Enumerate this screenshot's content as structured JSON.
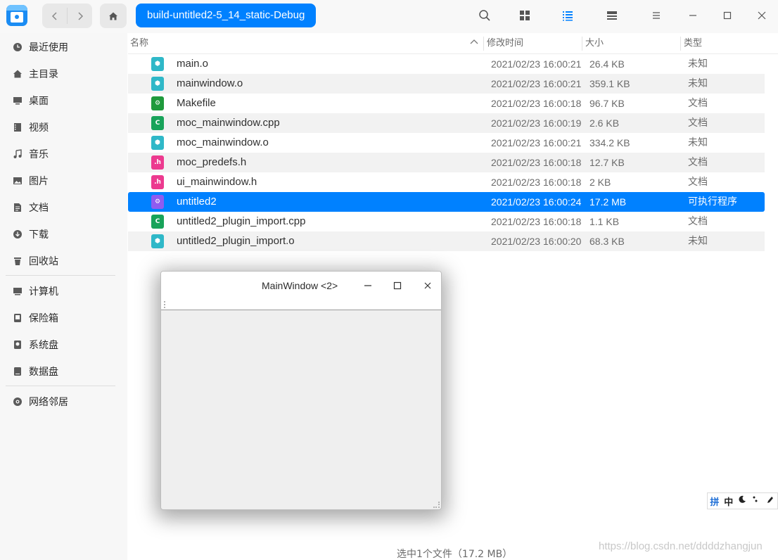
{
  "toolbar": {
    "back_icon": "chevron-left-icon",
    "forward_icon": "chevron-right-icon",
    "home_icon": "home-icon",
    "breadcrumb": "build-untitled2-5_14_static-Debug",
    "icons": [
      "search-icon",
      "icon-view-icon",
      "list-view-icon",
      "detail-view-icon",
      "menu-icon",
      "minimize-icon",
      "maximize-icon",
      "close-icon"
    ]
  },
  "sidebar": {
    "items": [
      {
        "label": "最近使用",
        "icon": "clock-icon"
      },
      {
        "label": "主目录",
        "icon": "home-icon"
      },
      {
        "label": "桌面",
        "icon": "desktop-icon"
      },
      {
        "label": "视频",
        "icon": "video-icon"
      },
      {
        "label": "音乐",
        "icon": "music-icon"
      },
      {
        "label": "图片",
        "icon": "picture-icon"
      },
      {
        "label": "文档",
        "icon": "document-icon"
      },
      {
        "label": "下载",
        "icon": "download-icon"
      },
      {
        "label": "回收站",
        "icon": "trash-icon"
      },
      {
        "label": "计算机",
        "icon": "computer-icon"
      },
      {
        "label": "保险箱",
        "icon": "vault-icon"
      },
      {
        "label": "系统盘",
        "icon": "system-disk-icon"
      },
      {
        "label": "数据盘",
        "icon": "data-disk-icon"
      },
      {
        "label": "网络邻居",
        "icon": "network-icon"
      }
    ]
  },
  "columns": {
    "name": "名称",
    "modified": "修改时间",
    "size": "大小",
    "type": "类型"
  },
  "files": [
    {
      "name": "main.o",
      "modified": "2021/02/23 16:00:21",
      "size": "26.4 KB",
      "type": "未知",
      "icon": "object-file-icon"
    },
    {
      "name": "mainwindow.o",
      "modified": "2021/02/23 16:00:21",
      "size": "359.1 KB",
      "type": "未知",
      "icon": "object-file-icon"
    },
    {
      "name": "Makefile",
      "modified": "2021/02/23 16:00:18",
      "size": "96.7 KB",
      "type": "文档",
      "icon": "makefile-icon"
    },
    {
      "name": "moc_mainwindow.cpp",
      "modified": "2021/02/23 16:00:19",
      "size": "2.6 KB",
      "type": "文档",
      "icon": "cpp-file-icon"
    },
    {
      "name": "moc_mainwindow.o",
      "modified": "2021/02/23 16:00:21",
      "size": "334.2 KB",
      "type": "未知",
      "icon": "object-file-icon"
    },
    {
      "name": "moc_predefs.h",
      "modified": "2021/02/23 16:00:18",
      "size": "12.7 KB",
      "type": "文档",
      "icon": "header-file-icon"
    },
    {
      "name": "ui_mainwindow.h",
      "modified": "2021/02/23 16:00:18",
      "size": "2 KB",
      "type": "文档",
      "icon": "header-file-icon"
    },
    {
      "name": "untitled2",
      "modified": "2021/02/23 16:00:24",
      "size": "17.2 MB",
      "type": "可执行程序",
      "icon": "executable-icon",
      "selected": true
    },
    {
      "name": "untitled2_plugin_import.cpp",
      "modified": "2021/02/23 16:00:18",
      "size": "1.1 KB",
      "type": "文档",
      "icon": "cpp-file-icon"
    },
    {
      "name": "untitled2_plugin_import.o",
      "modified": "2021/02/23 16:00:20",
      "size": "68.3 KB",
      "type": "未知",
      "icon": "object-file-icon"
    }
  ],
  "qt_window": {
    "title": "MainWindow <2>"
  },
  "status": "选中1个文件（17.2 MB）",
  "watermark": "https://blog.csdn.net/ddddzhangjun",
  "ime": [
    "拼",
    "中"
  ],
  "colors": {
    "accent": "#0081ff",
    "sidebar_bg": "#f7f7f7",
    "selected_text": "#ffffff"
  }
}
